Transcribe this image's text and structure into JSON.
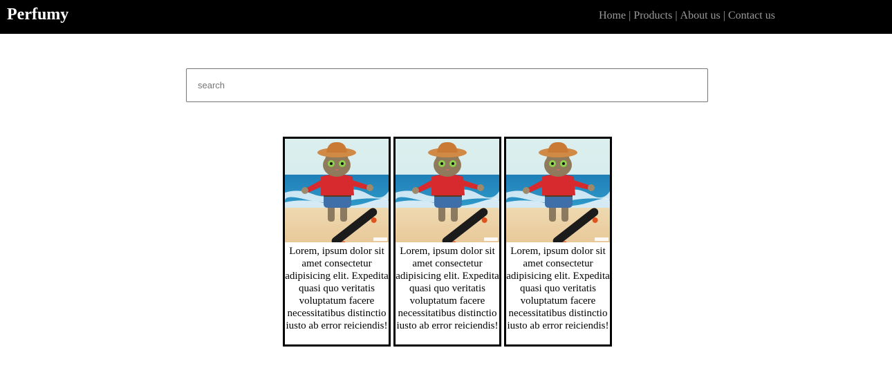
{
  "header": {
    "brand": "Perfumy",
    "nav": [
      {
        "label": "Home"
      },
      {
        "label": "Products"
      },
      {
        "label": "About us"
      },
      {
        "label": "Contact us"
      }
    ],
    "separator": "|"
  },
  "search": {
    "placeholder": "search",
    "value": ""
  },
  "products": [
    {
      "image": "cat-skateboard-cowboy-hat-image",
      "description": "Lorem, ipsum dolor sit amet consectetur adipisicing elit. Expedita quasi quo veritatis voluptatum facere necessitatibus distinctio iusto ab error reiciendis!"
    },
    {
      "image": "cat-skateboard-cowboy-hat-image",
      "description": "Lorem, ipsum dolor sit amet consectetur adipisicing elit. Expedita quasi quo veritatis voluptatum facere necessitatibus distinctio iusto ab error reiciendis!"
    },
    {
      "image": "cat-skateboard-cowboy-hat-image",
      "description": "Lorem, ipsum dolor sit amet consectetur adipisicing elit. Expedita quasi quo veritatis voluptatum facere necessitatibus distinctio iusto ab error reiciendis!"
    }
  ],
  "colors": {
    "navbar_bg": "#000000",
    "brand_text": "#ffffff",
    "nav_link": "#9a9a9a",
    "card_border": "#000000"
  }
}
